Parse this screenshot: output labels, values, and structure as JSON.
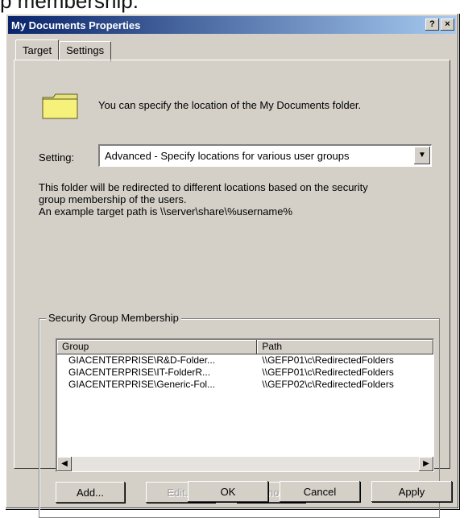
{
  "caption": "p membership.",
  "window": {
    "title": "My Documents Properties",
    "help_btn": "?",
    "close_btn": "×"
  },
  "tabs": [
    {
      "label": "Target",
      "active": true
    },
    {
      "label": "Settings",
      "active": false
    }
  ],
  "target": {
    "intro": "You can specify the location of the My Documents folder.",
    "setting_label": "Setting:",
    "setting_value": "Advanced - Specify locations for various user groups",
    "desc_line1": "This folder will be redirected to different locations based on the security",
    "desc_line2": "group membership of the users.",
    "desc_line3": "An example target path is \\\\server\\share\\%username%",
    "group_title": "Security Group Membership",
    "columns": [
      "Group",
      "Path"
    ],
    "rows": [
      {
        "group": "GIACENTERPRISE\\R&D-Folder...",
        "path": "\\\\GEFP01\\c\\RedirectedFolders"
      },
      {
        "group": "GIACENTERPRISE\\IT-FolderR...",
        "path": "\\\\GEFP01\\c\\RedirectedFolders"
      },
      {
        "group": "GIACENTERPRISE\\Generic-Fol...",
        "path": "\\\\GEFP02\\c\\RedirectedFolders"
      }
    ],
    "add_label": "Add...",
    "edit_label": "Edit...",
    "remove_label": "Remove"
  },
  "footer": {
    "ok": "OK",
    "cancel": "Cancel",
    "apply": "Apply"
  },
  "colors": {
    "title_bar": "#0a246a",
    "face": "#d4d0c8",
    "folder": "#f5f17a"
  }
}
